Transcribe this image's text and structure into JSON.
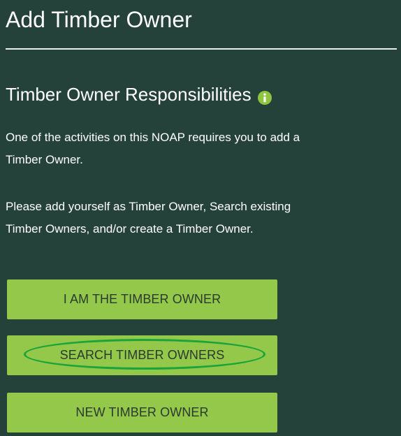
{
  "page": {
    "title": "Add Timber Owner"
  },
  "section": {
    "title": "Timber Owner Responsibilities",
    "info_icon": "info-icon",
    "paragraph1_line1": "One of the activities on this NOAP requires you to add a",
    "paragraph1_line2": "Timber Owner.",
    "paragraph2_line1": "Please add yourself as Timber Owner, Search existing",
    "paragraph2_line2": "Timber Owners, and/or create a Timber Owner."
  },
  "buttons": {
    "i_am_owner": "I AM THE TIMBER OWNER",
    "search_owners": "SEARCH TIMBER OWNERS",
    "new_owner": "NEW TIMBER OWNER"
  },
  "colors": {
    "background": "#24423a",
    "button": "#93c84a",
    "button_text": "#2b3a2e",
    "highlight_ring": "#1aa43a",
    "info_icon": "#8fc541"
  }
}
